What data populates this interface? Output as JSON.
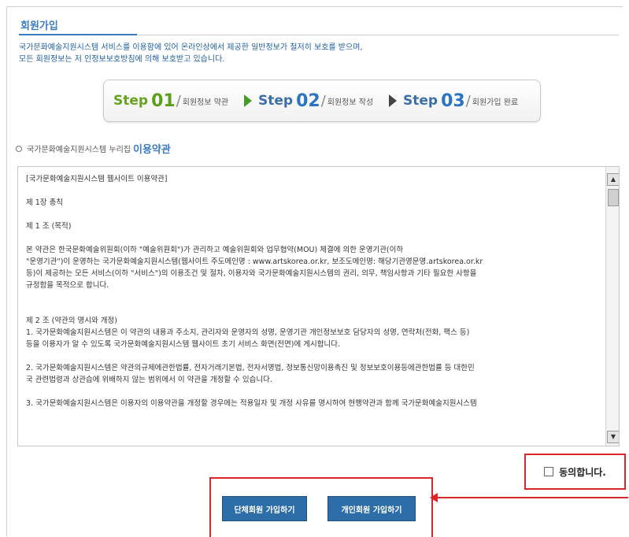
{
  "page_title": "회원가입",
  "intro": [
    "국가문화예술지원시스템 서비스를 이용함에 있어 온라인상에서 제공한 일반정보가 철저히 보호를 받으며,",
    "모든 회원정보는 저 인정보보호방침에 의해 보호받고 있습니다."
  ],
  "steps": [
    {
      "word": "Step",
      "num": "01",
      "label": "회원정보 약관"
    },
    {
      "word": "Step",
      "num": "02",
      "label": "회원정보 작성"
    },
    {
      "word": "Step",
      "num": "03",
      "label": "회원가입 완료"
    }
  ],
  "terms_heading": {
    "prefix": "국가문화예술지원시스템 누리집",
    "emphasis": "이용약관"
  },
  "terms": [
    "[국가문화예술지원시스템 웹사이트 이용약관]",
    "",
    "제 1장 총칙",
    "",
    "제 1 조 (목적)",
    "",
    "본 약관은 한국문화예술위원회(이하 \"예술위원회\")가 관리하고 예술위원회와 업무협약(MOU) 체결에 의한 운영기관(이하",
    "\"운영기관\")이 운영하는 국가문화예술지원시스템(웹사이트 주도메인명 : www.artskorea.or.kr, 보조도메인명: 해당기관영문명.artskorea.or.kr",
    "등)이 제공하는 모든 서비스(이하 \"서비스\")의 이용조건 및 절차, 이용자와 국가문화예술지원시스템의 권리, 의무, 책임사항과 기타 필요한 사항을",
    "규정함을 목적으로 합니다.",
    "",
    "",
    "제 2 조 (약관의 명시와 개정)",
    "1. 국가문화예술지원시스템은 이 약관의 내용과 주소지, 관리자와 운영자의 성명, 운영기관 개인정보보호 담당자의 성명, 연락처(전화, 팩스 등)",
    "등을 이용자가 알 수 있도록 국가문화예술지원시스템 웹사이트 초기 서비스 화면(전면)에 게시합니다.",
    "",
    "2. 국가문화예술지원시스템은 약관의규제에관한법률, 전자거래기본법, 전자서명법, 정보통신망이용촉진 및 정보보호이용등에관한법률 등 대한민",
    "국 관련법령과 상관습에 위배하지 않는 범위에서 이 약관을 개정할 수 있습니다.",
    "",
    "3. 국가문화예술지원시스템은 이용자의 이용약관을 개정할 경우에는 적용일자 및 개정 사유를 명시하여 현행약관과 함께 국가문화예술지원시스템"
  ],
  "agree_label": "동의합니다.",
  "buttons": {
    "group": "단체회원 가입하기",
    "personal": "개인회원 가입하기"
  },
  "colors": {
    "accent_blue": "#3b7bbf",
    "step_green": "#5a9e1a",
    "button_blue": "#2e6ea8",
    "highlight_red": "#d9262a"
  }
}
